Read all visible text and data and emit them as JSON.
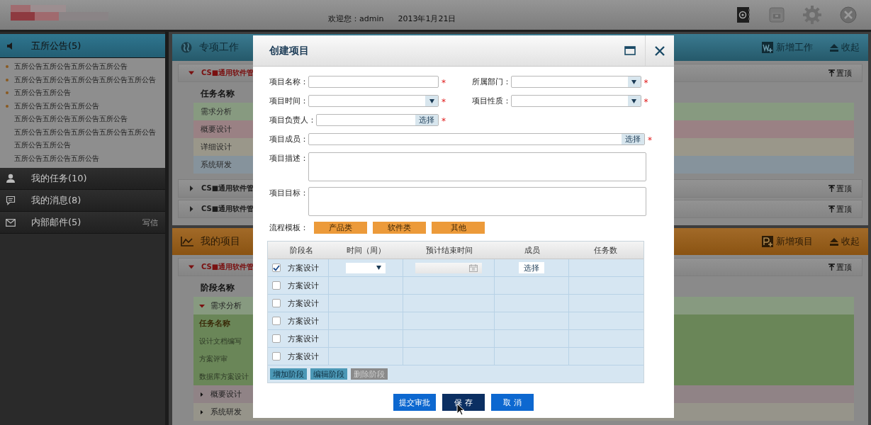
{
  "header": {
    "welcome": "欢迎您：admin",
    "date": "2013年1月21日"
  },
  "sidebar": {
    "sections": [
      {
        "title": "五所公告(5)",
        "expanded": true,
        "items": [
          {
            "text": "五所公告五所公告五所公告五所公告",
            "unread": true
          },
          {
            "text": "五所公告五所公告五所公告五所公告五所公告",
            "unread": true
          },
          {
            "text": "五所公告五所公告",
            "unread": true
          },
          {
            "text": "五所公告五所公告五所公告",
            "unread": true
          },
          {
            "text": "五所公告五所公告五所公告五所公告",
            "unread": false
          },
          {
            "text": "五所公告五所公告五所公告五所公告五所公告",
            "unread": false
          },
          {
            "text": "五所公告五所公告",
            "unread": false
          },
          {
            "text": "五所公告五所公告五所公告",
            "unread": false
          }
        ]
      },
      {
        "title": "我的任务(10)",
        "expanded": false
      },
      {
        "title": "我的消息(8)",
        "expanded": false
      },
      {
        "title": "内部邮件(5)",
        "expanded": false,
        "action": "写信"
      }
    ]
  },
  "work_panel": {
    "title": "专项工作",
    "add": "新增工作",
    "collapse": "收起",
    "task_header": "任务名称",
    "projects": [
      {
        "name": "CS■通用软件管",
        "expanded": true,
        "pin": "置顶"
      },
      {
        "name": "CS■通用软件管",
        "expanded": false,
        "pin": "置顶"
      },
      {
        "name": "CS■通用软件管",
        "expanded": false,
        "pin": "置顶"
      }
    ],
    "tasks": [
      {
        "name": "需求分析",
        "color": "#879a80"
      },
      {
        "name": "概要设计",
        "color": "#9a8184"
      },
      {
        "name": "详细设计",
        "color": "#9a978a"
      },
      {
        "name": "系统研发",
        "color": "#86939c"
      }
    ]
  },
  "project_panel": {
    "title": "我的项目",
    "add": "新增项目",
    "collapse": "收起",
    "project": {
      "name": "CS■通用软件管",
      "expanded": true,
      "pin": "置顶"
    },
    "stage_header": "阶段名称",
    "stages": [
      {
        "name": "需求分析",
        "expanded": true,
        "color": "#879a80",
        "task_header": "任务名称",
        "children": [
          "设计文档编写",
          "方案评审",
          "数据库方案设计"
        ]
      },
      {
        "name": "概要设计",
        "expanded": false,
        "color": "#908386"
      },
      {
        "name": "系统研发",
        "expanded": false,
        "color": "#96948a"
      }
    ]
  },
  "dialog": {
    "title": "创建项目",
    "required_mark": "*",
    "rows": [
      [
        {
          "label": "项目名称：",
          "kind": "text",
          "required": true
        },
        {
          "label": "所属部门：",
          "kind": "select",
          "required": true
        }
      ],
      [
        {
          "label": "项目时间：",
          "kind": "select",
          "required": true
        },
        {
          "label": "项目性质：",
          "kind": "select",
          "required": true
        }
      ],
      [
        {
          "label": "项目负责人：",
          "kind": "picker",
          "button": "选择",
          "required": true
        }
      ],
      [
        {
          "label": "项目成员：",
          "kind": "multipicker",
          "button": "选择",
          "required": true
        }
      ],
      [
        {
          "label": "项目描述：",
          "kind": "textarea",
          "required": false
        }
      ],
      [
        {
          "label": "项目目标：",
          "kind": "textarea",
          "required": false
        }
      ]
    ],
    "template": {
      "label": "流程模板：",
      "options": [
        "产品类",
        "软件类",
        "其他"
      ]
    },
    "stage_table": {
      "columns": [
        "阶段名",
        "时间（周）",
        "预计结束时间",
        "成员",
        "任务数"
      ],
      "rows": [
        {
          "checked": true,
          "name": "方案设计",
          "editing": true,
          "member_button": "选择"
        },
        {
          "checked": false,
          "name": "方案设计",
          "editing": false
        },
        {
          "checked": false,
          "name": "方案设计",
          "editing": false
        },
        {
          "checked": false,
          "name": "方案设计",
          "editing": false
        },
        {
          "checked": false,
          "name": "方案设计",
          "editing": false
        },
        {
          "checked": false,
          "name": "方案设计",
          "editing": false
        }
      ],
      "actions": [
        {
          "label": "增加阶段",
          "disabled": false
        },
        {
          "label": "编辑阶段",
          "disabled": false
        },
        {
          "label": "删除阶段",
          "disabled": true
        }
      ]
    },
    "buttons": [
      {
        "label": "提交审批",
        "selected": false
      },
      {
        "label": "保 存",
        "selected": true
      },
      {
        "label": "取 消",
        "selected": false
      }
    ]
  }
}
